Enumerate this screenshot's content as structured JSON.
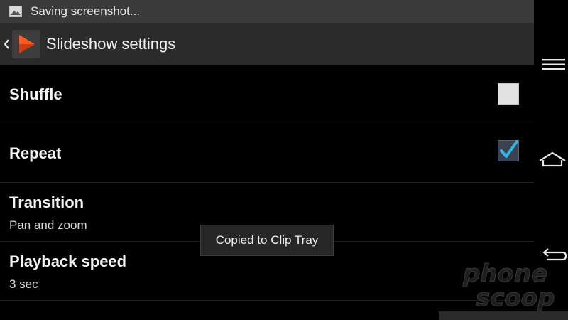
{
  "status_bar": {
    "text": "Saving screenshot...",
    "icon": "image-icon"
  },
  "action_bar": {
    "title": "Slideshow settings"
  },
  "settings": {
    "shuffle": {
      "title": "Shuffle",
      "checked": false
    },
    "repeat": {
      "title": "Repeat",
      "checked": true
    },
    "transition": {
      "title": "Transition",
      "value": "Pan and zoom"
    },
    "playback_speed": {
      "title": "Playback speed",
      "value": "3 sec"
    }
  },
  "toast": {
    "text": "Copied to Clip Tray"
  },
  "nav": {
    "menu_icon": "menu-icon",
    "home_icon": "home-icon",
    "back_icon": "back-icon"
  },
  "watermark": {
    "line1": "phone",
    "line2": "scoop"
  },
  "colors": {
    "accent_orange": "#ff5a1f",
    "check_blue": "#33b5e5"
  }
}
